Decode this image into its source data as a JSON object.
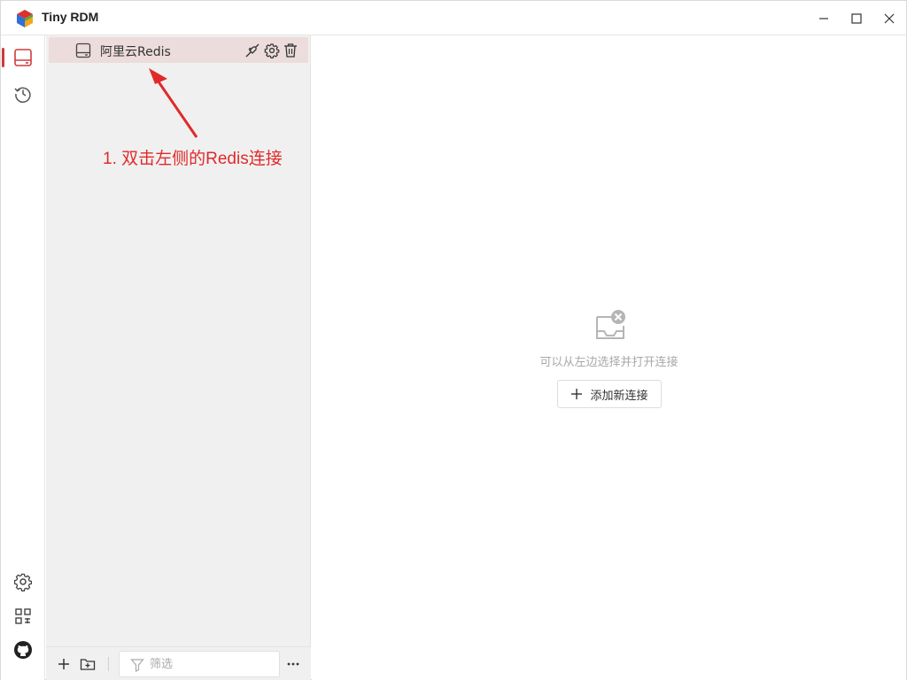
{
  "app": {
    "title": "Tiny RDM"
  },
  "window_controls": [
    "minimize-icon",
    "maximize-icon",
    "close-icon"
  ],
  "rail": {
    "items": [
      {
        "icon": "server-icon",
        "active": true
      },
      {
        "icon": "history-icon",
        "active": false
      }
    ],
    "bottom_items": [
      "gear-icon",
      "apps-grid-icon",
      "github-icon"
    ]
  },
  "connections": [
    {
      "label": "阿里云Redis",
      "icon": "server-icon",
      "actions": [
        "disconnect-icon",
        "gear-icon",
        "trash-icon"
      ]
    }
  ],
  "annotation": {
    "text": "1. 双击左侧的Redis连接",
    "color": "#e02a2a"
  },
  "footer": {
    "filter_placeholder": "筛选",
    "filter_value": ""
  },
  "main": {
    "empty_text": "可以从左边选择并打开连接",
    "add_button_label": "添加新连接"
  },
  "colors": {
    "accent": "#d03a3a",
    "selected_row": "#ecdcdc",
    "panel_bg": "#f0f0f0"
  }
}
